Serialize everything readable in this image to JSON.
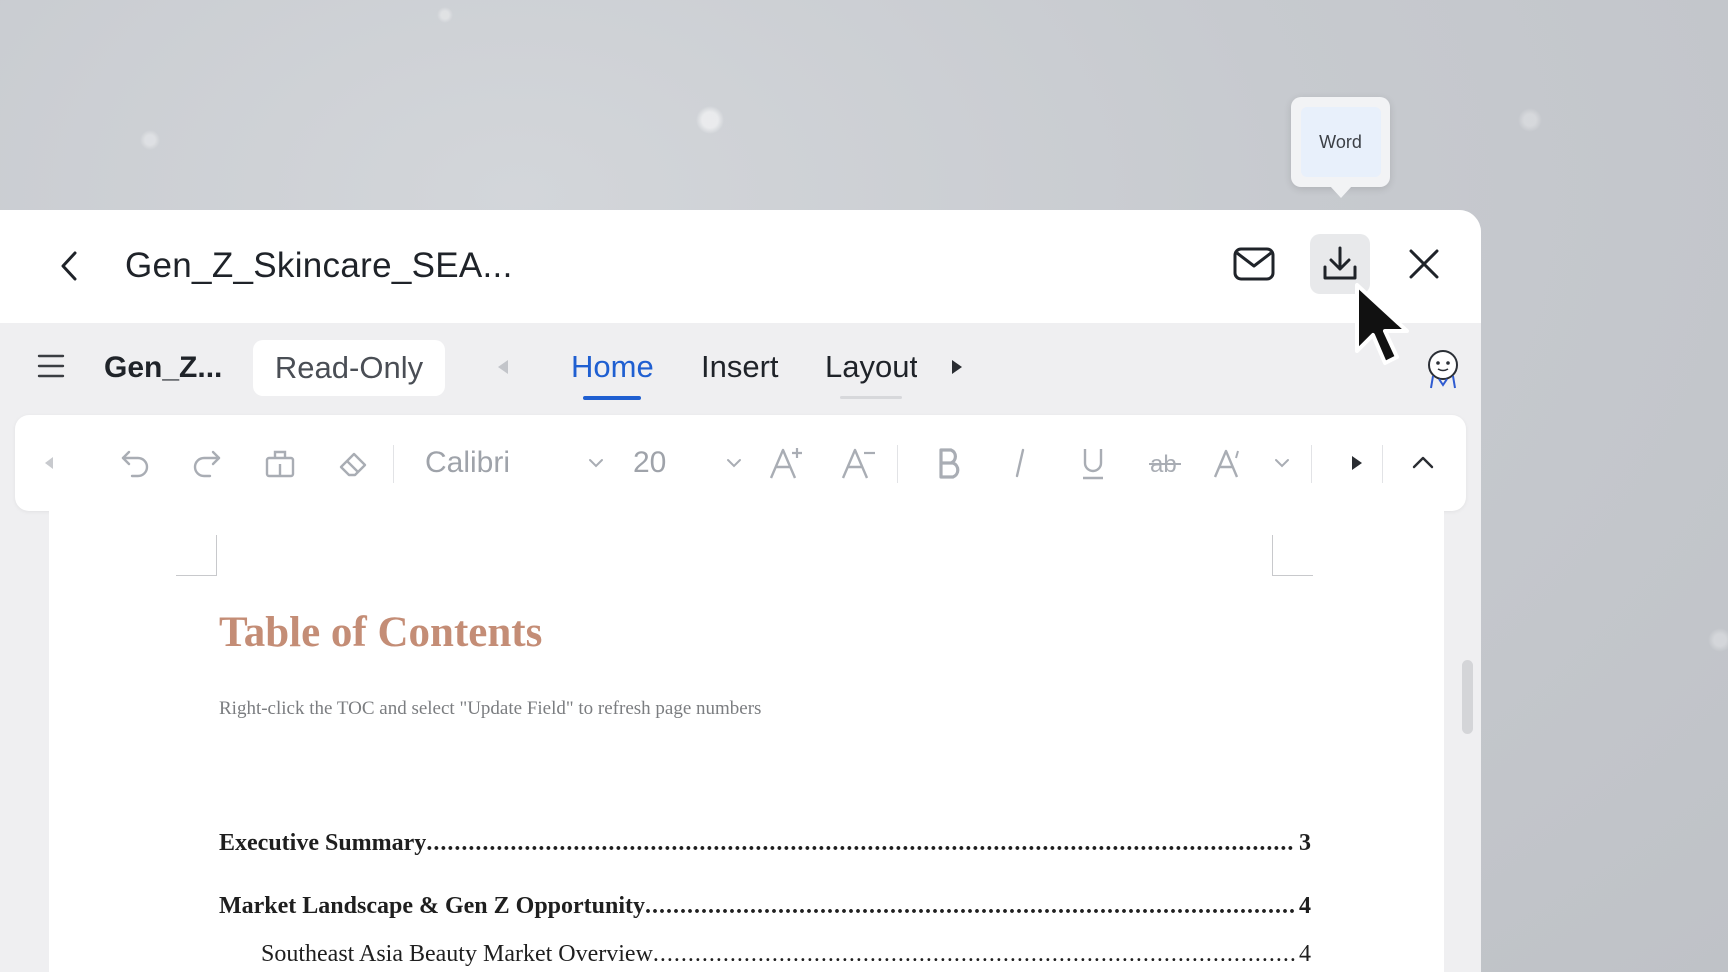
{
  "tooltip": {
    "label": "Word"
  },
  "titlebar": {
    "title": "Gen_Z_Skincare_SEA...",
    "back_icon": "chevron-left-icon",
    "mail_icon": "mail-icon",
    "download_icon": "download-icon",
    "close_icon": "close-icon"
  },
  "tabbar": {
    "doc_name": "Gen_Z...",
    "mode_badge": "Read-Only",
    "tabs": [
      {
        "label": "Home",
        "active": true
      },
      {
        "label": "Insert",
        "active": false
      },
      {
        "label": "Layout",
        "active": false
      }
    ]
  },
  "toolbar": {
    "font_name": "Calibri",
    "font_size": "20"
  },
  "document": {
    "toc_title": "Table of Contents",
    "toc_hint": "Right-click the TOC and select \"Update Field\" to refresh page numbers",
    "entries": [
      {
        "text": "Executive Summary",
        "page": "3",
        "level": 1
      },
      {
        "text": "Market Landscape & Gen Z Opportunity",
        "page": "4",
        "level": 1
      },
      {
        "text": "Southeast Asia Beauty Market Overview",
        "page": "4",
        "level": 2
      }
    ]
  },
  "colors": {
    "accent": "#1f5fd1",
    "toc_title": "#c48d76"
  }
}
